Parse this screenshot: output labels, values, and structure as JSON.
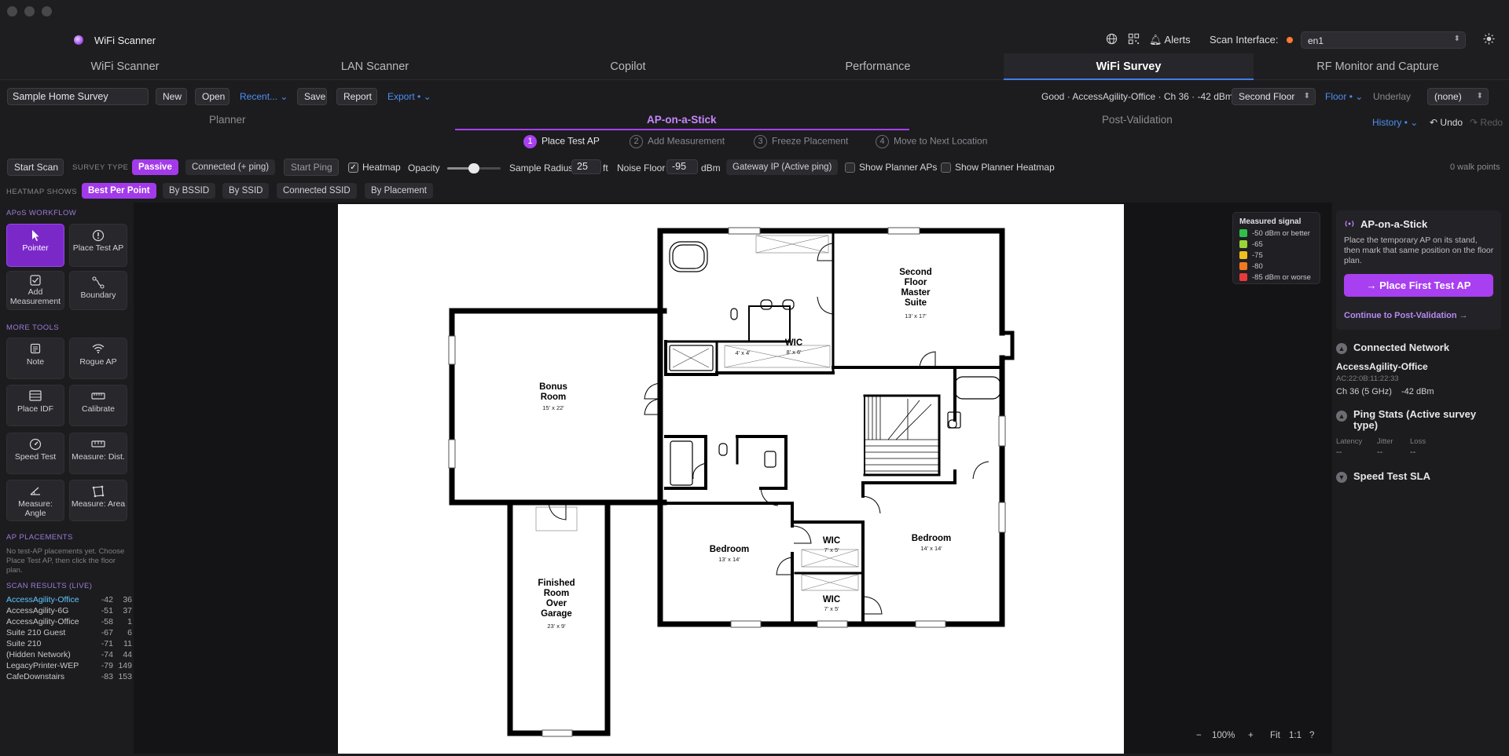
{
  "app": {
    "title": "WiFi Scanner"
  },
  "header": {
    "alerts_label": "Alerts",
    "scan_interface_label": "Scan Interface:",
    "scan_interface_value": "en1",
    "status_dot_color": "#ff7a2f"
  },
  "tabs": [
    {
      "label": "WiFi Scanner"
    },
    {
      "label": "LAN Scanner"
    },
    {
      "label": "Copilot"
    },
    {
      "label": "Performance"
    },
    {
      "label": "WiFi Survey",
      "active": true
    },
    {
      "label": "RF Monitor and Capture"
    }
  ],
  "toolbar": {
    "survey_name": "Sample Home Survey",
    "new_label": "New",
    "open_label": "Open",
    "recent_label": "Recent...",
    "save_label": "Save",
    "report_label": "Report",
    "export_label": "Export",
    "connection_status": "Good · AccessAgility-Office · Ch 36 · -42 dBm",
    "floor_value": "Second Floor",
    "floor_menu_label": "Floor",
    "underlay_label": "Underlay",
    "underlay_value": "(none)"
  },
  "phases": {
    "planner": "Planner",
    "ap_on_a_stick": "AP-on-a-Stick",
    "post_validation": "Post-Validation",
    "history_label": "History",
    "undo_label": "Undo",
    "redo_label": "Redo"
  },
  "steps": [
    {
      "num": "1",
      "label": "Place Test AP",
      "active": true
    },
    {
      "num": "2",
      "label": "Add Measurement"
    },
    {
      "num": "3",
      "label": "Freeze Placement"
    },
    {
      "num": "4",
      "label": "Move to Next Location"
    }
  ],
  "scanbar": {
    "start_scan": "Start Scan",
    "survey_type_label": "SURVEY TYPE",
    "passive_label": "Passive",
    "connected_label": "Connected (+ ping)",
    "start_ping": "Start Ping",
    "heatmap_label": "Heatmap",
    "opacity_label": "Opacity",
    "opacity_value": 0.5,
    "sample_radius_label": "Sample Radius",
    "sample_radius_value": "25",
    "sample_radius_unit": "ft",
    "noise_floor_label": "Noise Floor",
    "noise_floor_value": "-95",
    "noise_floor_unit": "dBm",
    "gateway_label": "Gateway IP (Active ping)",
    "show_planner_aps": "Show Planner APs",
    "show_planner_heatmap": "Show Planner Heatmap",
    "walk_points": "0 walk points"
  },
  "heatmap_shows": {
    "label": "HEATMAP SHOWS",
    "options": [
      "Best Per Point",
      "By BSSID",
      "By SSID",
      "Connected SSID",
      "By Placement"
    ]
  },
  "sidebar": {
    "workflow_label": "APoS WORKFLOW",
    "workflow_tools": [
      "Pointer",
      "Place Test AP",
      "Add Measurement",
      "Boundary"
    ],
    "more_tools_label": "MORE TOOLS",
    "more_tools": [
      "Note",
      "Rogue AP",
      "Place IDF",
      "Calibrate",
      "Speed Test",
      "Measure: Dist.",
      "Measure: Angle",
      "Measure: Area"
    ],
    "ap_placements_label": "AP PLACEMENTS",
    "ap_placements_note": "No test-AP placements yet. Choose Place Test AP, then click the floor plan.",
    "scan_results_label": "SCAN RESULTS (LIVE)",
    "scan_results": [
      {
        "name": "AccessAgility-Office",
        "rssi": "-42",
        "ch": "36"
      },
      {
        "name": "AccessAgility-6G",
        "rssi": "-51",
        "ch": "37"
      },
      {
        "name": "AccessAgility-Office",
        "rssi": "-58",
        "ch": "1"
      },
      {
        "name": "Suite 210 Guest",
        "rssi": "-67",
        "ch": "6"
      },
      {
        "name": "Suite 210",
        "rssi": "-71",
        "ch": "11"
      },
      {
        "name": "(Hidden Network)",
        "rssi": "-74",
        "ch": "44"
      },
      {
        "name": "LegacyPrinter-WEP",
        "rssi": "-79",
        "ch": "149"
      },
      {
        "name": "CafeDownstairs",
        "rssi": "-83",
        "ch": "153"
      }
    ]
  },
  "floorplan": {
    "rooms": [
      {
        "name": "Second Floor Master Suite",
        "lines": [
          "Second",
          "Floor",
          "Master",
          "Suite"
        ],
        "dim": "13' x 17'"
      },
      {
        "name": "WIC",
        "dim": "8' x 6'"
      },
      {
        "name": "Bonus Room",
        "lines": [
          "Bonus",
          "Room"
        ],
        "dim": "15' x 22'"
      },
      {
        "name": "Bedroom",
        "dim": "13' x 14'"
      },
      {
        "name": "WIC",
        "dim": "7' x 5'"
      },
      {
        "name": "WIC",
        "dim": "7' x 5'"
      },
      {
        "name": "Bedroom",
        "dim": "14' x 14'"
      },
      {
        "name": "Finished Room Over Garage",
        "lines": [
          "Finished",
          "Room",
          "Over",
          "Garage"
        ],
        "dim": "23' x 9'"
      }
    ],
    "misc_dim": "4' x 4'"
  },
  "legend": {
    "title": "Measured signal",
    "items": [
      {
        "label": "-50 dBm or better",
        "color": "#2fc24a"
      },
      {
        "label": "-65",
        "color": "#9ad43a"
      },
      {
        "label": "-75",
        "color": "#f0c020"
      },
      {
        "label": "-80",
        "color": "#f07a20"
      },
      {
        "label": "-85 dBm or worse",
        "color": "#e83a3a"
      }
    ]
  },
  "zoom": {
    "minus": "−",
    "value": "100%",
    "plus": "+",
    "fit": "Fit",
    "one_to_one": "1:1",
    "help": "?"
  },
  "right_panel": {
    "title": "AP-on-a-Stick",
    "description": "Place the temporary AP on its stand, then mark that same position on the floor plan.",
    "cta_label": "Place First Test AP",
    "continue_label": "Continue to Post-Validation →",
    "connected_network_label": "Connected Network",
    "network_name": "AccessAgility-Office",
    "bssid": "AC:22:0B:11:22:33",
    "channel": "Ch 36 (5 GHz)",
    "rssi": "-42 dBm",
    "ping_stats_label": "Ping Stats (Active survey type)",
    "latency_label": "Latency",
    "jitter_label": "Jitter",
    "loss_label": "Loss",
    "latency_value": "--",
    "jitter_value": "--",
    "loss_value": "--",
    "speed_test_label": "Speed Test SLA"
  }
}
